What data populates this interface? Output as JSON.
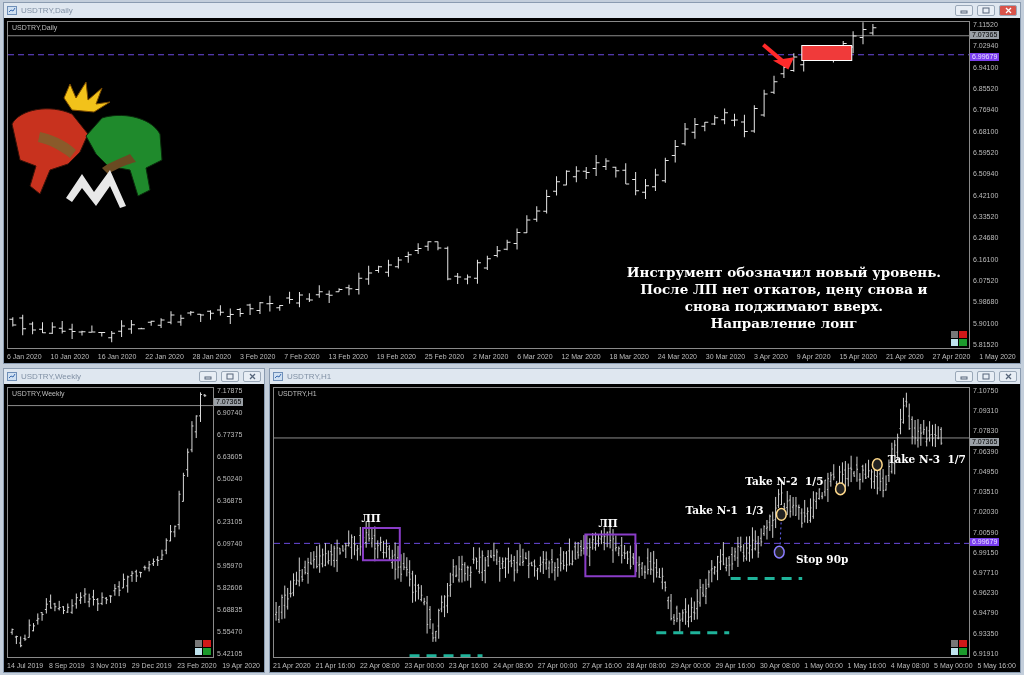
{
  "daily_window": {
    "title": "USDTRY,Daily",
    "active": true,
    "chart_label": "USDTRY,Daily",
    "price_labels": [
      "7.11520",
      "7.02940",
      "6.94100",
      "6.85520",
      "6.76940",
      "6.68100",
      "6.59520",
      "6.50940",
      "6.42100",
      "6.33520",
      "6.24680",
      "6.16100",
      "6.07520",
      "5.98680",
      "5.90100",
      "5.81520"
    ],
    "current_price": "7.07365",
    "level_price": "6.99679",
    "date_labels": [
      "6 Jan 2020",
      "10 Jan 2020",
      "16 Jan 2020",
      "22 Jan 2020",
      "28 Jan 2020",
      "3 Feb 2020",
      "7 Feb 2020",
      "13 Feb 2020",
      "19 Feb 2020",
      "25 Feb 2020",
      "2 Mar 2020",
      "6 Mar 2020",
      "12 Mar 2020",
      "18 Mar 2020",
      "24 Mar 2020",
      "30 Mar 2020",
      "3 Apr 2020",
      "9 Apr 2020",
      "15 Apr 2020",
      "21 Apr 2020",
      "27 Apr 2020",
      "1 May 2020"
    ],
    "note": [
      "Инструмент обозначил новый уровень.",
      "После ЛП нет откатов, цену снова и",
      "снова поджимают вверх.",
      "Направление лонг"
    ]
  },
  "weekly_window": {
    "title": "USDTRY,Weekly",
    "active": false,
    "chart_label": "USDTRY,Weekly",
    "price_labels": [
      "7.17875",
      "6.90740",
      "6.77375",
      "6.63605",
      "6.50240",
      "6.36875",
      "6.23105",
      "6.09740",
      "5.95970",
      "5.82606",
      "5.68835",
      "5.55470",
      "5.42105"
    ],
    "current_price": "7.07365",
    "date_labels": [
      "14 Jul 2019",
      "8 Sep 2019",
      "3 Nov 2019",
      "29 Dec 2019",
      "23 Feb 2020",
      "19 Apr 2020"
    ]
  },
  "h1_window": {
    "title": "USDTRY,H1",
    "active": false,
    "chart_label": "USDTRY,H1",
    "price_labels": [
      "7.10750",
      "7.09310",
      "7.07830",
      "7.06390",
      "7.04950",
      "7.03510",
      "7.02030",
      "7.00590",
      "6.99150",
      "6.97710",
      "6.96230",
      "6.94790",
      "6.93350",
      "6.91910"
    ],
    "current_price": "7.07365",
    "level_price": "6.99679",
    "date_labels": [
      "21 Apr 2020",
      "21 Apr 16:00",
      "22 Apr 08:00",
      "23 Apr 00:00",
      "23 Apr 16:00",
      "24 Apr 08:00",
      "27 Apr 00:00",
      "27 Apr 16:00",
      "28 Apr 08:00",
      "29 Apr 00:00",
      "29 Apr 16:00",
      "30 Apr 08:00",
      "1 May 00:00",
      "1 May 16:00",
      "4 May 08:00",
      "5 May 00:00",
      "5 May 16:00"
    ],
    "annotations": [
      {
        "kind": "range",
        "text": "ЛП"
      },
      {
        "kind": "range",
        "text": "ЛП"
      },
      {
        "kind": "take",
        "text": "Take N-1  1/3"
      },
      {
        "kind": "take",
        "text": "Take N-2  1/5"
      },
      {
        "kind": "take",
        "text": "Take N-3  1/7"
      },
      {
        "kind": "stop",
        "text": "Stop 90р"
      }
    ]
  }
}
